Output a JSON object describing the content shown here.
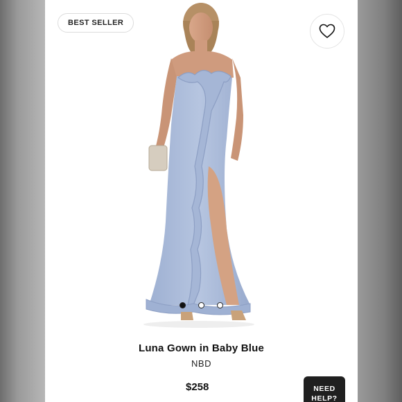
{
  "badge": {
    "label": "BEST SELLER"
  },
  "wishlist": {
    "icon": "heart-icon"
  },
  "carousel": {
    "slides": 3,
    "active_index": 0
  },
  "product": {
    "name": "Luna Gown in Baby Blue",
    "brand": "NBD",
    "price": "$258",
    "color_hex": "#a9b9d8"
  },
  "help": {
    "line1": "NEED",
    "line2": "HELP?"
  }
}
